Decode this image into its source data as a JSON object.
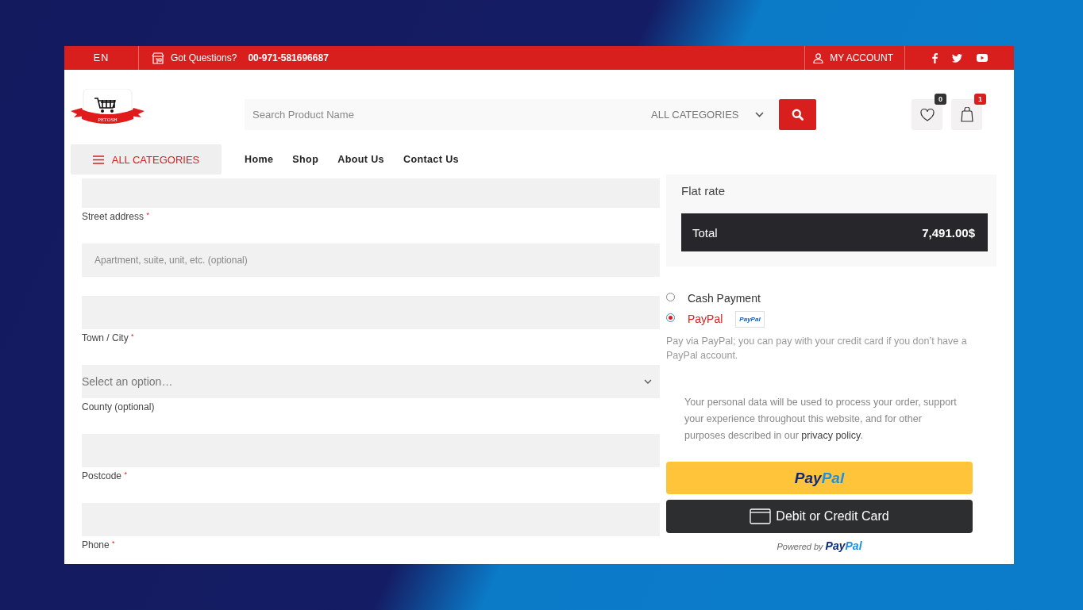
{
  "top_bar": {
    "language": "EN",
    "questions_label": "Got Questions?",
    "phone": "00-971-581696687",
    "account": "MY ACCOUNT"
  },
  "header": {
    "logo_text": "PETOSH",
    "search": {
      "placeholder": "Search Product Name",
      "category": "ALL CATEGORIES"
    },
    "wishlist_count": "0",
    "cart_count": "1"
  },
  "nav": {
    "categories_button": "ALL CATEGORIES",
    "links": [
      "Home",
      "Shop",
      "About Us",
      "Contact Us"
    ]
  },
  "form_fields": [
    {
      "kind": "input",
      "label": "Street address",
      "required_mark": "*"
    },
    {
      "kind": "input",
      "placeholder": "Apartment, suite, unit, etc. (optional)"
    },
    {
      "kind": "input",
      "label": "Town / City",
      "required_mark": "*"
    },
    {
      "kind": "select",
      "placeholder": "Select an option…",
      "label": "County (optional)"
    },
    {
      "kind": "input",
      "label": "Postcode",
      "required_mark": "*"
    },
    {
      "kind": "input",
      "label": "Phone",
      "required_mark": "*"
    }
  ],
  "order_summary": {
    "shipping_method": "Flat rate",
    "total_label": "Total",
    "total_value": "7,491.00$"
  },
  "payment_methods": [
    {
      "label": "Cash Payment",
      "selected": false
    },
    {
      "label": "PayPal",
      "selected": true,
      "badge": "PayPal"
    }
  ],
  "payment_description": "Pay via PayPal; you can pay with your credit card if you don’t have a PayPal account.",
  "privacy_notice": {
    "text": "Your personal data will be used to process your order, support your experience throughout this website, and for other purposes described in our ",
    "link": "privacy policy",
    "end": "."
  },
  "paypal_checkout": {
    "paypal_button": [
      "Pay",
      "Pal"
    ],
    "card_button": "Debit or Credit Card",
    "powered_by": "Powered by",
    "powered_brand": [
      "Pay",
      "Pal"
    ]
  }
}
